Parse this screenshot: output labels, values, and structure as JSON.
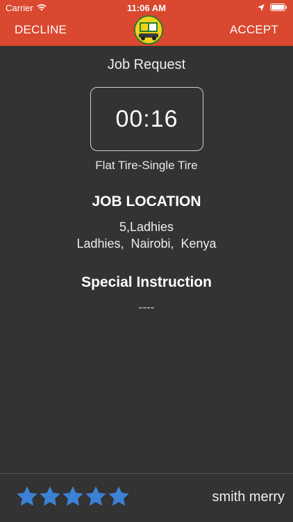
{
  "status_bar": {
    "carrier": "Carrier",
    "time": "11:06 AM",
    "wifi_icon": "wifi-icon",
    "location_icon": "location-arrow-icon",
    "battery_icon": "battery-icon"
  },
  "header": {
    "decline_label": "DECLINE",
    "accept_label": "ACCEPT",
    "logo": "app-logo",
    "color": "#d9482f"
  },
  "job": {
    "title": "Job Request",
    "timer": "00:16",
    "service": "Flat Tire-Single Tire"
  },
  "location": {
    "heading": "JOB LOCATION",
    "line1": "5,Ladhies",
    "line2": "Ladhies,  Nairobi,  Kenya"
  },
  "instruction": {
    "heading": "Special Instruction",
    "text": "----"
  },
  "footer": {
    "rating": 5,
    "rating_max": 5,
    "star_color": "#3b82d6",
    "user_name": "smith merry"
  },
  "colors": {
    "background": "#333333",
    "accent": "#d9482f"
  }
}
